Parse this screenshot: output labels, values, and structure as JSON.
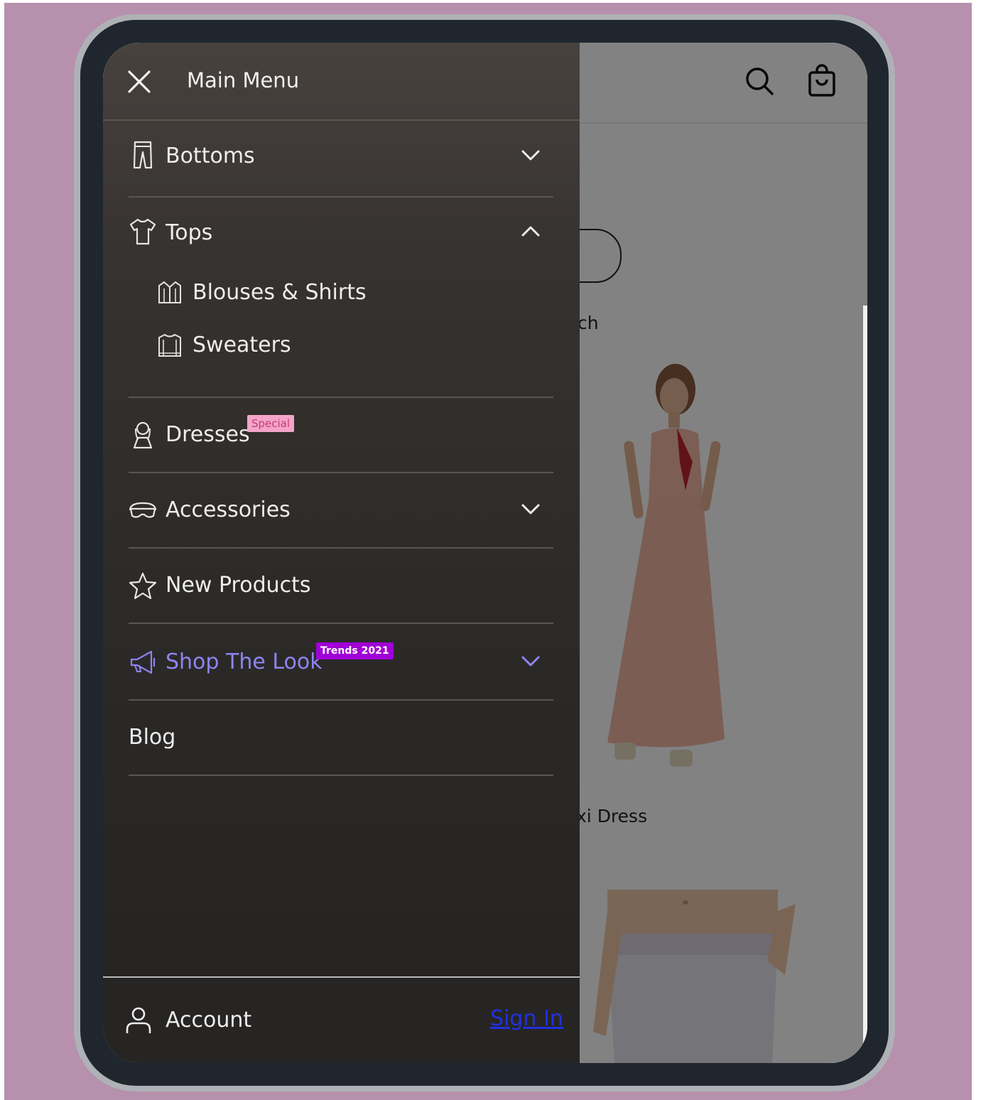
{
  "colors": {
    "backdrop": "#b690ad",
    "device_frame": "#1f262e",
    "drawer_top": "#48423e",
    "drawer_bottom": "#252322",
    "special_badge_bg": "#f4a4c8",
    "special_badge_text": "#c0406e",
    "trends_badge_bg": "#a000d6",
    "trends_badge_text": "#ffffff",
    "shop_the_look_accent": "#8d84f0",
    "sign_in_link": "#2230e0"
  },
  "header": {
    "icons": [
      "search-icon",
      "shopping-bag-icon"
    ]
  },
  "page": {
    "fragments": [
      "ch",
      "xi Dress"
    ]
  },
  "drawer": {
    "title": "Main Menu",
    "close_icon": "close-icon",
    "items": [
      {
        "label": "Bottoms",
        "icon": "pants-icon",
        "chevron": "chevron-down-icon",
        "expanded": false
      },
      {
        "label": "Tops",
        "icon": "tshirt-icon",
        "chevron": "chevron-up-icon",
        "expanded": true,
        "children": [
          {
            "label": "Blouses & Shirts",
            "icon": "blouse-icon"
          },
          {
            "label": "Sweaters",
            "icon": "sweater-icon"
          }
        ]
      },
      {
        "label": "Dresses",
        "icon": "dress-icon",
        "badge": "Special"
      },
      {
        "label": "Accessories",
        "icon": "sunglasses-icon",
        "chevron": "chevron-down-icon",
        "expanded": false
      },
      {
        "label": "New Products",
        "icon": "star-icon"
      },
      {
        "label": "Shop The Look",
        "icon": "megaphone-icon",
        "badge": "Trends 2021",
        "chevron": "chevron-down-icon",
        "expanded": false
      },
      {
        "label": "Blog"
      }
    ],
    "footer": {
      "account_label": "Account",
      "account_icon": "user-icon",
      "sign_in_label": "Sign In"
    }
  }
}
